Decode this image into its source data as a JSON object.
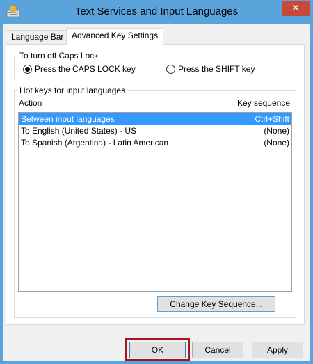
{
  "window": {
    "title": "Text Services and Input Languages",
    "close_glyph": "✕",
    "app_icon": "keyboard-globe-icon"
  },
  "tabs": [
    {
      "label": "Language Bar",
      "active": false
    },
    {
      "label": "Advanced Key Settings",
      "active": true
    }
  ],
  "caps_lock": {
    "legend": "To turn off Caps Lock",
    "options": [
      {
        "label": "Press the CAPS LOCK key",
        "checked": true
      },
      {
        "label": "Press the SHIFT key",
        "checked": false
      }
    ]
  },
  "hotkeys": {
    "legend": "Hot keys for input languages",
    "col_action": "Action",
    "col_sequence": "Key sequence",
    "rows": [
      {
        "action": "Between input languages",
        "sequence": "Ctrl+Shift",
        "selected": true
      },
      {
        "action": "To English (United States) - US",
        "sequence": "(None)",
        "selected": false
      },
      {
        "action": "To Spanish (Argentina) - Latin American",
        "sequence": "(None)",
        "selected": false
      }
    ],
    "change_button": "Change Key Sequence..."
  },
  "buttons": {
    "ok": "OK",
    "cancel": "Cancel",
    "apply": "Apply"
  },
  "colors": {
    "titlebar": "#5ba3db",
    "close": "#c7493b",
    "selection": "#3399ff",
    "highlight_box": "#a8141c"
  }
}
